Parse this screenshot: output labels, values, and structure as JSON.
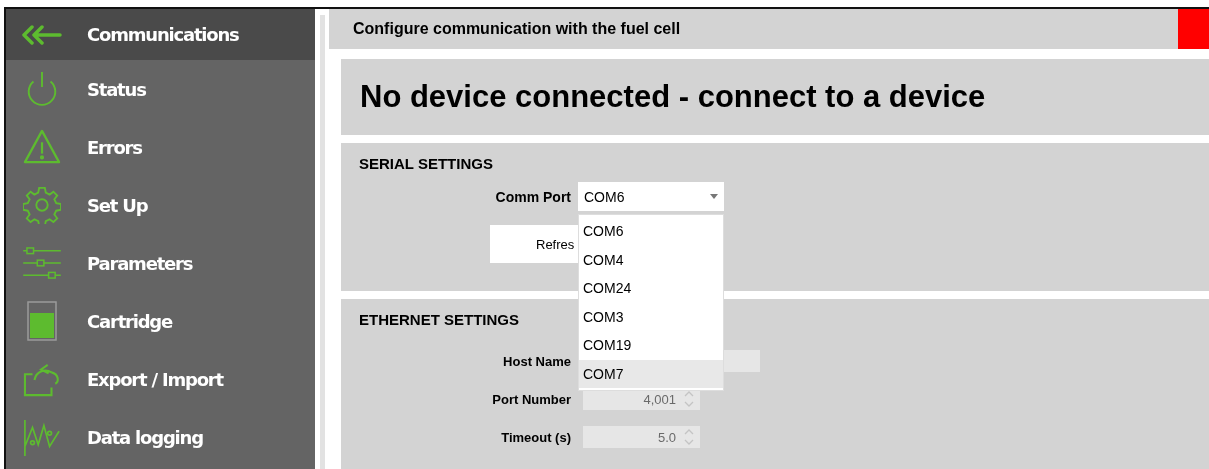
{
  "sidebar": {
    "items": [
      {
        "label": "Communications",
        "selected": true
      },
      {
        "label": "Status",
        "selected": false
      },
      {
        "label": "Errors",
        "selected": false
      },
      {
        "label": "Set Up",
        "selected": false
      },
      {
        "label": "Parameters",
        "selected": false
      },
      {
        "label": "Cartridge",
        "selected": false
      },
      {
        "label": "Export / Import",
        "selected": false
      },
      {
        "label": "Data logging",
        "selected": false
      }
    ]
  },
  "header": {
    "title": "Configure communication with the fuel cell",
    "connected": false
  },
  "banner": {
    "text": "No device connected - connect to a device"
  },
  "serial_settings": {
    "title": "SERIAL SETTINGS",
    "comm_port": {
      "label": "Comm Port",
      "value": "COM6",
      "expanded": true,
      "options": [
        {
          "label": "COM6",
          "highlighted": false
        },
        {
          "label": "COM4",
          "highlighted": false
        },
        {
          "label": "COM24",
          "highlighted": false
        },
        {
          "label": "COM3",
          "highlighted": false
        },
        {
          "label": "COM19",
          "highlighted": false
        },
        {
          "label": "COM7",
          "highlighted": true
        }
      ]
    },
    "refresh_button": "Refres"
  },
  "ethernet_settings": {
    "title": "ETHERNET SETTINGS",
    "fields": [
      {
        "label": "Host Name",
        "kind": "text",
        "disabled": true
      },
      {
        "label": "Port Number",
        "kind": "spinner",
        "value": "4,001",
        "disabled": true
      },
      {
        "label": "Timeout (s)",
        "kind": "spinner",
        "value": "5.0",
        "disabled": true
      }
    ]
  }
}
